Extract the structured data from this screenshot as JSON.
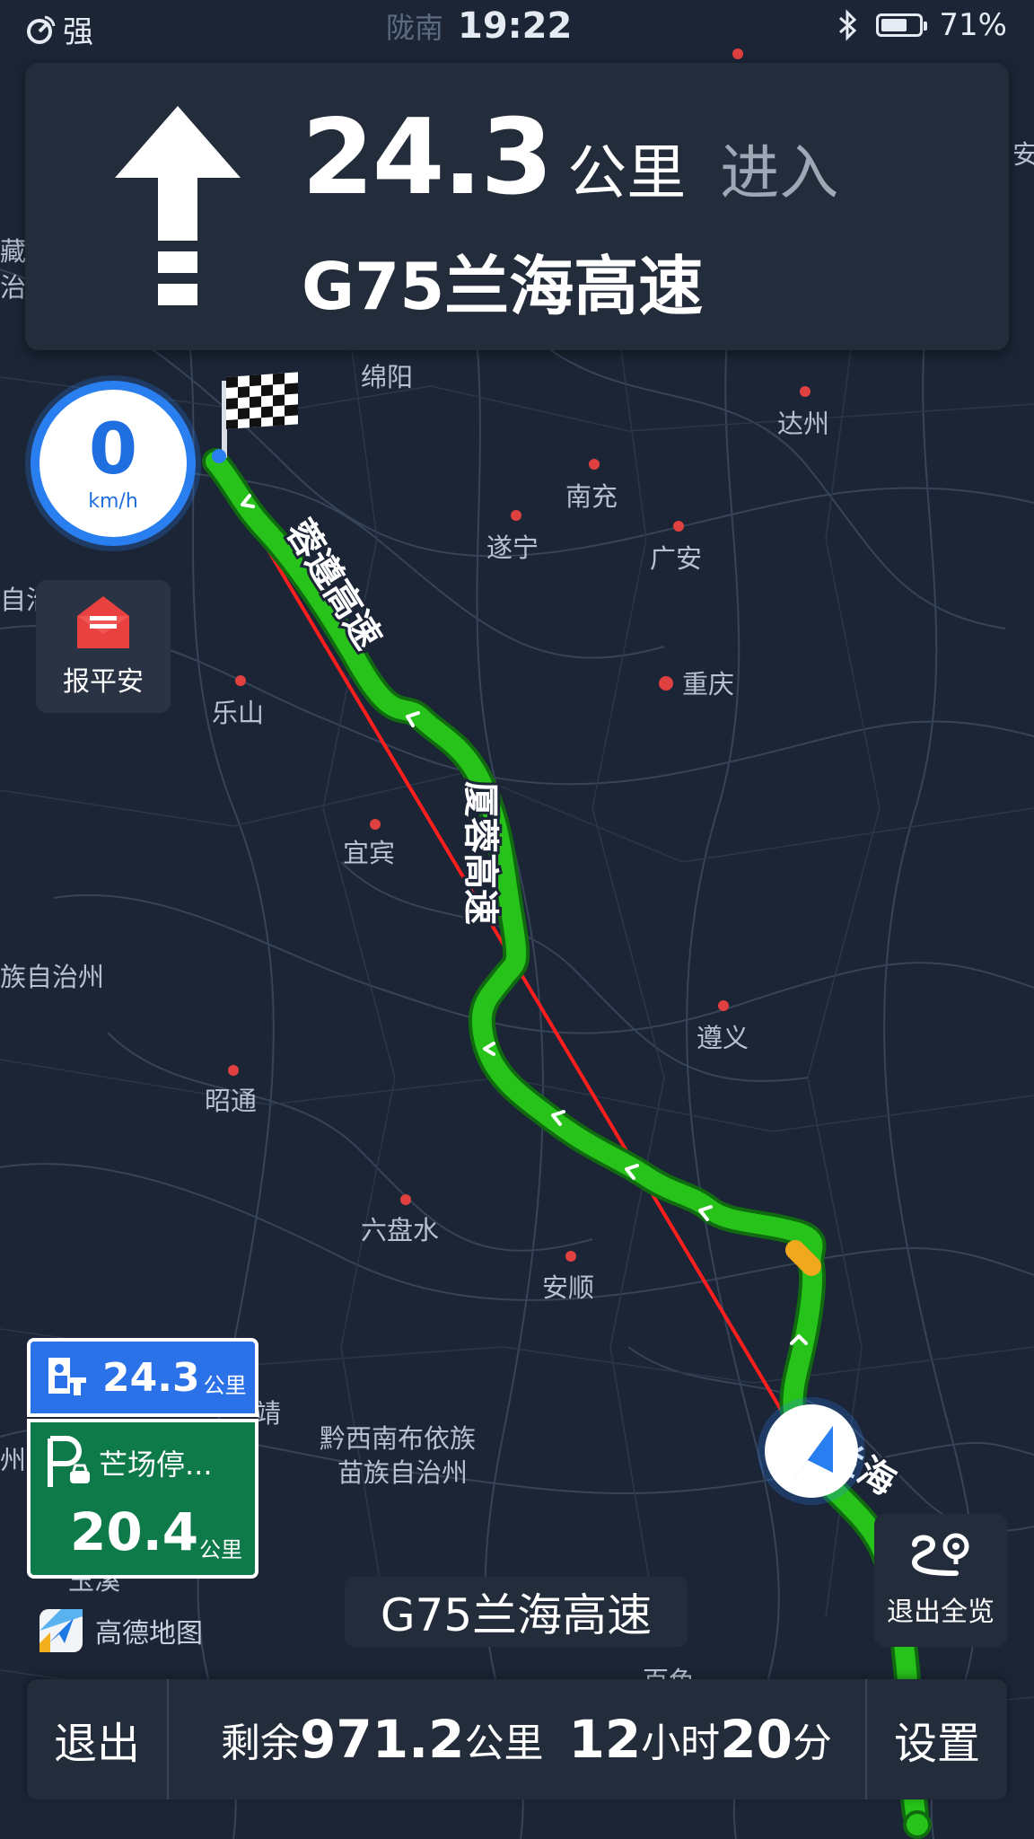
{
  "status_bar": {
    "signal_label": "强",
    "location": "陇南",
    "time": "19:22",
    "battery_percent": "71%",
    "battery_level": 0.71
  },
  "navigation": {
    "distance_value": "24.3",
    "distance_unit": "公里",
    "action": "进入",
    "next_road": "G75兰海高速"
  },
  "speed": {
    "value": "0",
    "unit": "km/h"
  },
  "safety_button": {
    "label": "报平安"
  },
  "map": {
    "cities": [
      "绵阳",
      "达州",
      "南充",
      "遂宁",
      "广安",
      "重庆",
      "乐山",
      "宜宾",
      "遵义",
      "昭通",
      "六盘水",
      "安顺",
      "黔西南布依族",
      "苗族自治州",
      "族自治州",
      "自治州",
      "藏",
      "治",
      "安",
      "州",
      "玉溪",
      "百色",
      "靖"
    ],
    "road_labels": [
      "蓉遵高速",
      "厦蓉高速",
      "兰海"
    ]
  },
  "service_area": {
    "distance_value": "24.3",
    "distance_unit": "公里"
  },
  "parking_area": {
    "name": "芒场停...",
    "distance_value": "20.4",
    "distance_unit": "公里"
  },
  "logo": {
    "text": "高德地图"
  },
  "current_road": "G75兰海高速",
  "overview_button": {
    "label": "退出全览"
  },
  "bottom_bar": {
    "exit_label": "退出",
    "remaining_prefix": "剩余",
    "remaining_distance": "971.2",
    "remaining_distance_unit": "公里",
    "remaining_hours": "12",
    "hours_unit": "小时",
    "remaining_minutes": "20",
    "minutes_unit": "分",
    "settings_label": "设置"
  },
  "colors": {
    "route": "#27c21a",
    "direct_line": "#ff1e1e",
    "panel": "#232c3a",
    "map_bg": "#1b2536",
    "accent_blue": "#2a7ff0",
    "service_blue": "#2b71e8",
    "parking_green": "#0e7a4a"
  }
}
